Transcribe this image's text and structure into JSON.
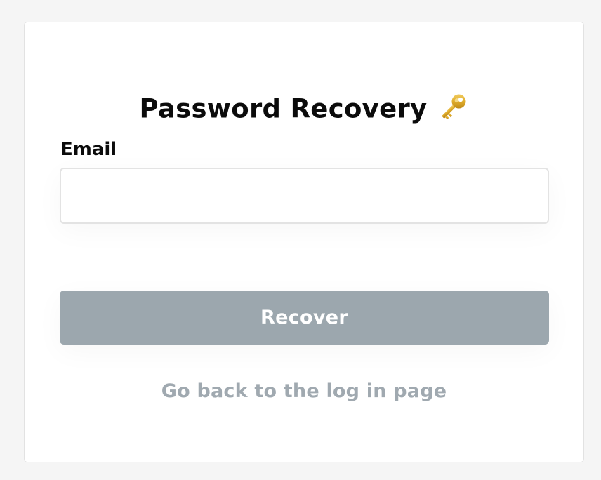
{
  "form": {
    "title": "Password Recovery",
    "title_icon": "key-icon",
    "email_label": "Email",
    "email_value": "",
    "email_placeholder": "",
    "submit_label": "Recover",
    "back_link_label": "Go back to the log in page"
  },
  "colors": {
    "page_background": "#f5f5f5",
    "card_background": "#ffffff",
    "button_background": "#9ca7ae",
    "button_text": "#ffffff",
    "link_text": "#a0a9b0",
    "title_text": "#0b0b0b"
  }
}
